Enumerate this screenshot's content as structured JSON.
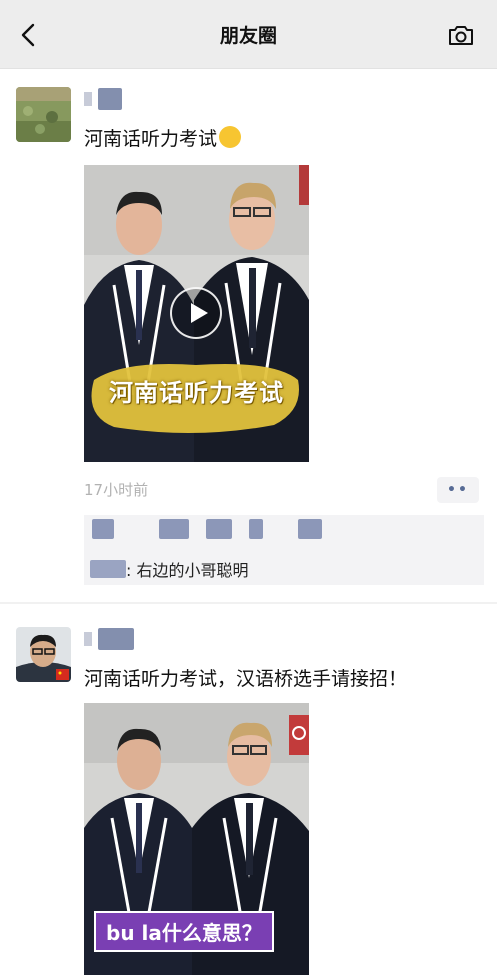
{
  "nav": {
    "title": "朋友圈",
    "back_icon": "chevron-left-icon",
    "camera_icon": "camera-icon"
  },
  "posts": [
    {
      "text": "河南话听力考试",
      "emoji": "laughing-tears-emoji",
      "video_caption": "河南话听力考试",
      "timestamp": "17小时前",
      "more_label": "••",
      "comment": {
        "text": ": 右边的小哥聪明"
      }
    },
    {
      "text": "河南话听力考试，汉语桥选手请接招！",
      "video_caption": "bu la什么意思？"
    }
  ],
  "colors": {
    "nav_bg": "#ededed",
    "link": "#576b95",
    "timestamp": "#b2b2b2",
    "comment_bg": "#f3f3f5"
  }
}
